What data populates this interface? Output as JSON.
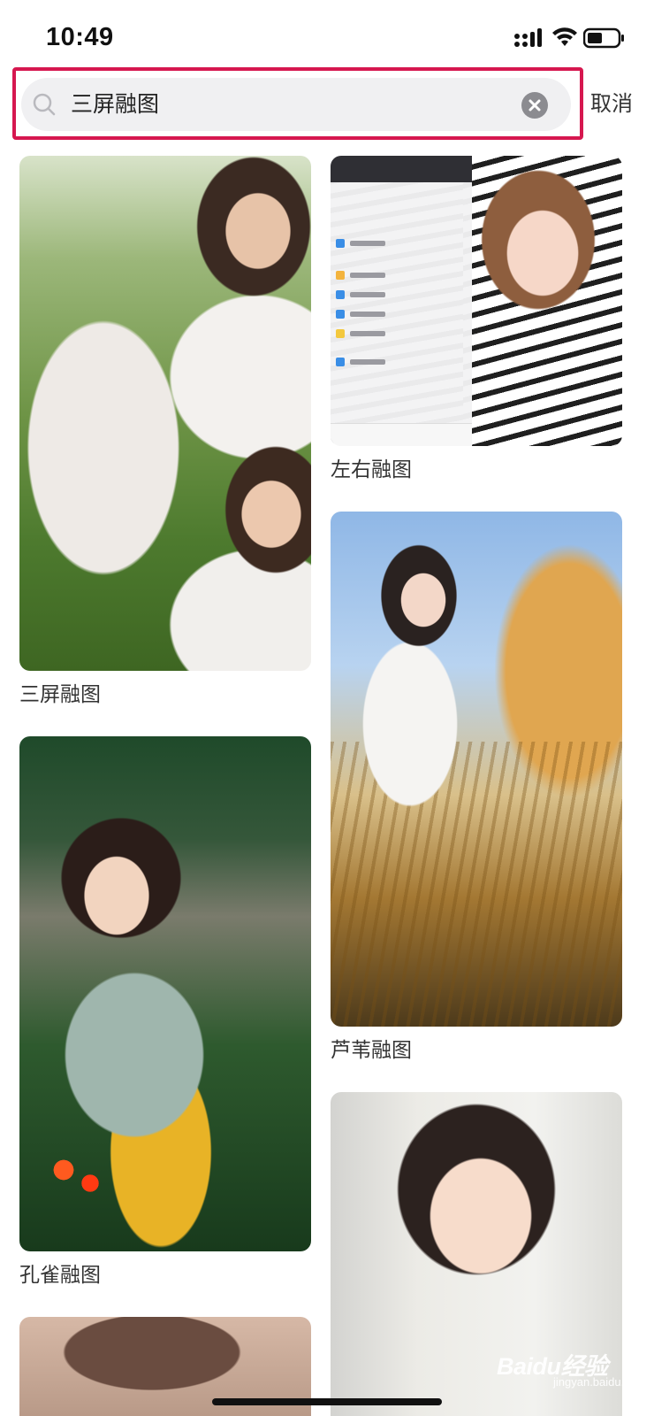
{
  "status_bar": {
    "time": "10:49"
  },
  "search": {
    "query": "三屏融图",
    "cancel_label": "取消",
    "highlight_color": "#d6174f"
  },
  "results": [
    {
      "title": "三屏融图"
    },
    {
      "title": "左右融图"
    },
    {
      "title": "芦苇融图"
    },
    {
      "title": "孔雀融图"
    },
    {
      "title": ""
    },
    {
      "title": ""
    }
  ],
  "watermark": {
    "logo_text": "Baidu经验",
    "sub_text": "jingyan.baidu.com"
  },
  "icons": [
    "signal-icon",
    "wifi-icon",
    "battery-icon",
    "search-icon",
    "clear-icon"
  ]
}
